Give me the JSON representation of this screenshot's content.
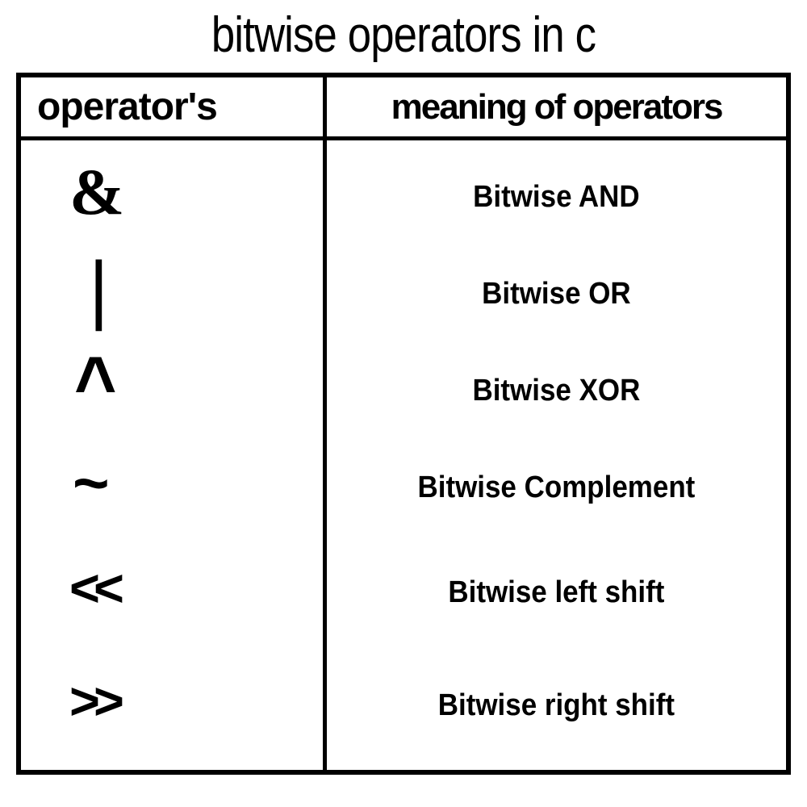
{
  "title": "bitwise operators in c",
  "headers": {
    "left": "operator's",
    "right": "meaning of operators"
  },
  "rows": [
    {
      "symbol": "&",
      "meaning": "Bitwise AND"
    },
    {
      "symbol": "|",
      "meaning": "Bitwise OR"
    },
    {
      "symbol": "^",
      "meaning": "Bitwise XOR"
    },
    {
      "symbol": "~",
      "meaning": "Bitwise Complement"
    },
    {
      "symbol": "<<",
      "meaning": "Bitwise left shift"
    },
    {
      "symbol": ">>",
      "meaning": "Bitwise right shift"
    }
  ]
}
